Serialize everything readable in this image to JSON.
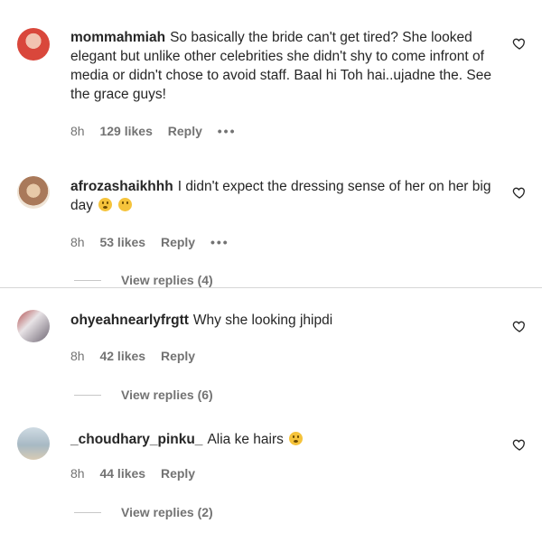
{
  "comments": [
    {
      "username": "mommahmiah",
      "text": "So basically the bride can't get tired? She looked elegant but unlike other celebrities she didn't shy to come infront of media or didn't chose to avoid staff. Baal hi Toh hai..ujadne the. See the grace guys!",
      "time": "8h",
      "likes": "129 likes",
      "reply": "Reply",
      "more": "•••",
      "avatar_color": "#d9473b"
    },
    {
      "username": "afrozashaikhhh",
      "text": "I didn't expect the dressing sense of her on her big day",
      "time": "8h",
      "likes": "53 likes",
      "reply": "Reply",
      "more": "•••",
      "view_replies": "View replies (4)",
      "avatar_color": "#c9a37a"
    },
    {
      "username": "ohyeahnearlyfrgtt",
      "text": "Why she looking jhipdi",
      "time": "8h",
      "likes": "42 likes",
      "reply": "Reply",
      "view_replies": "View replies (6)",
      "avatar_color": "#8a7f86"
    },
    {
      "username": "_choudhary_pinku_",
      "text": "Alia ke hairs",
      "time": "8h",
      "likes": "44 likes",
      "reply": "Reply",
      "view_replies": "View replies (2)",
      "avatar_color": "#b9c7cf"
    }
  ]
}
